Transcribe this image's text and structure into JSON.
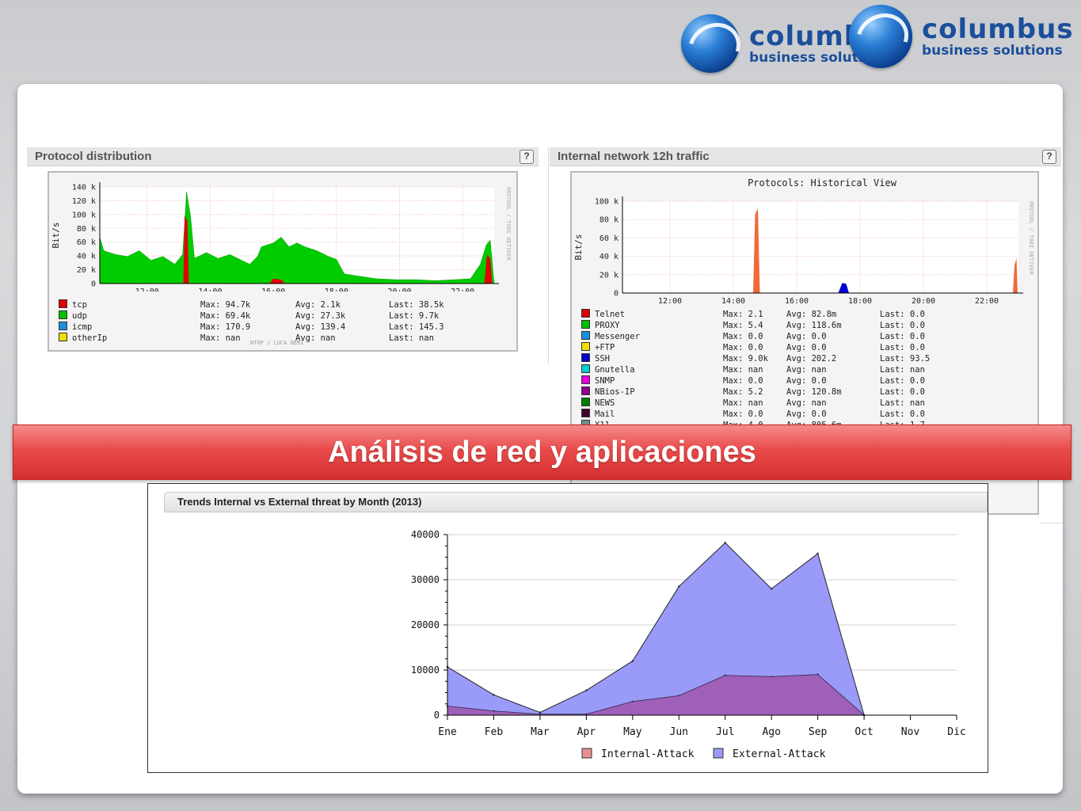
{
  "logos": [
    {
      "name": "columbus",
      "tagline": "business solutions"
    },
    {
      "name": "columbus",
      "tagline": "business solutions"
    }
  ],
  "panel_left": {
    "title": "Protocol distribution",
    "help": "?",
    "chart_data": {
      "type": "area",
      "ylabel": "Bit/s",
      "yticks": [
        "140 k",
        "120 k",
        "100 k",
        "80 k",
        "60 k",
        "40 k",
        "20 k",
        "0"
      ],
      "xticks": [
        "12:00",
        "14:00",
        "16:00",
        "18:00",
        "20:00",
        "22:00"
      ],
      "side_label": "RRDTOOL / TOBI OETIKER",
      "footer": "NTOP / LUCA DERI",
      "legend": [
        {
          "name": "tcp",
          "color": "#e00000",
          "max": "Max: 94.7k",
          "avg": "Avg: 2.1k",
          "last": "Last: 38.5k"
        },
        {
          "name": "udp",
          "color": "#00c000",
          "max": "Max: 69.4k",
          "avg": "Avg: 27.3k",
          "last": "Last: 9.7k"
        },
        {
          "name": "icmp",
          "color": "#1a8fe0",
          "max": "Max: 170.9",
          "avg": "Avg: 139.4",
          "last": "Last: 145.3"
        },
        {
          "name": "otherIp",
          "color": "#f0e000",
          "max": "Max: nan",
          "avg": "Avg: nan",
          "last": "Last: nan"
        }
      ]
    }
  },
  "panel_right": {
    "title": "Internal network 12h traffic",
    "help": "?",
    "chart_data": {
      "type": "area",
      "title": "Protocols: Historical View",
      "ylabel": "Bit/s",
      "yticks": [
        "100 k",
        "80 k",
        "60 k",
        "40 k",
        "20 k",
        "0"
      ],
      "xticks": [
        "12:00",
        "14:00",
        "16:00",
        "18:00",
        "20:00",
        "22:00"
      ],
      "side_label": "RRDTOOL / TOBI OETIKER",
      "legend": [
        {
          "name": "Telnet",
          "color": "#e00000",
          "max": "Max: 2.1",
          "avg": "Avg: 82.8m",
          "last": "Last: 0.0"
        },
        {
          "name": "PROXY",
          "color": "#00c000",
          "max": "Max: 5.4",
          "avg": "Avg: 118.6m",
          "last": "Last: 0.0"
        },
        {
          "name": "Messenger",
          "color": "#1a8fe0",
          "max": "Max: 0.0",
          "avg": "Avg: 0.0",
          "last": "Last: 0.0"
        },
        {
          "name": "+FTP",
          "color": "#f0e000",
          "max": "Max: 0.0",
          "avg": "Avg: 0.0",
          "last": "Last: 0.0"
        },
        {
          "name": "SSH",
          "color": "#0000d0",
          "max": "Max: 9.0k",
          "avg": "Avg: 202.2",
          "last": "Last: 93.5"
        },
        {
          "name": "Gnutella",
          "color": "#00d0d0",
          "max": "Max: nan",
          "avg": "Avg: nan",
          "last": "Last: nan"
        },
        {
          "name": "SNMP",
          "color": "#e000e0",
          "max": "Max: 0.0",
          "avg": "Avg: 0.0",
          "last": "Last: 0.0"
        },
        {
          "name": "NBios-IP",
          "color": "#900090",
          "max": "Max: 5.2",
          "avg": "Avg: 120.8m",
          "last": "Last: 0.0"
        },
        {
          "name": "NEWS",
          "color": "#008000",
          "max": "Max: nan",
          "avg": "Avg: nan",
          "last": "Last: nan"
        },
        {
          "name": "Mail",
          "color": "#400030",
          "max": "Max: 0.0",
          "avg": "Avg: 0.0",
          "last": "Last: 0.0"
        },
        {
          "name": "X11",
          "color": "#709090",
          "max": "Max: 4.0",
          "avg": "Avg: 805.6m",
          "last": "Last: 1.7"
        }
      ]
    }
  },
  "banner": {
    "text": "Análisis de red y aplicaciones"
  },
  "trends": {
    "title": "Trends Internal vs External threat by Month (2013)",
    "chart_data": {
      "type": "area",
      "categories": [
        "Ene",
        "Feb",
        "Mar",
        "Apr",
        "May",
        "Jun",
        "Jul",
        "Ago",
        "Sep",
        "Oct",
        "Nov",
        "Dic"
      ],
      "ylim": [
        0,
        40000
      ],
      "yticks": [
        0,
        10000,
        20000,
        30000,
        40000
      ],
      "series": [
        {
          "name": "Internal-Attack",
          "color": "#e89090",
          "values": [
            2000,
            900,
            200,
            200,
            3000,
            4300,
            8800,
            8500,
            9000,
            0,
            null,
            null
          ]
        },
        {
          "name": "External-Attack",
          "color": "#9a9af8",
          "values": [
            10700,
            4500,
            600,
            5500,
            12000,
            28500,
            38200,
            28000,
            35800,
            0,
            null,
            null
          ]
        }
      ]
    }
  }
}
